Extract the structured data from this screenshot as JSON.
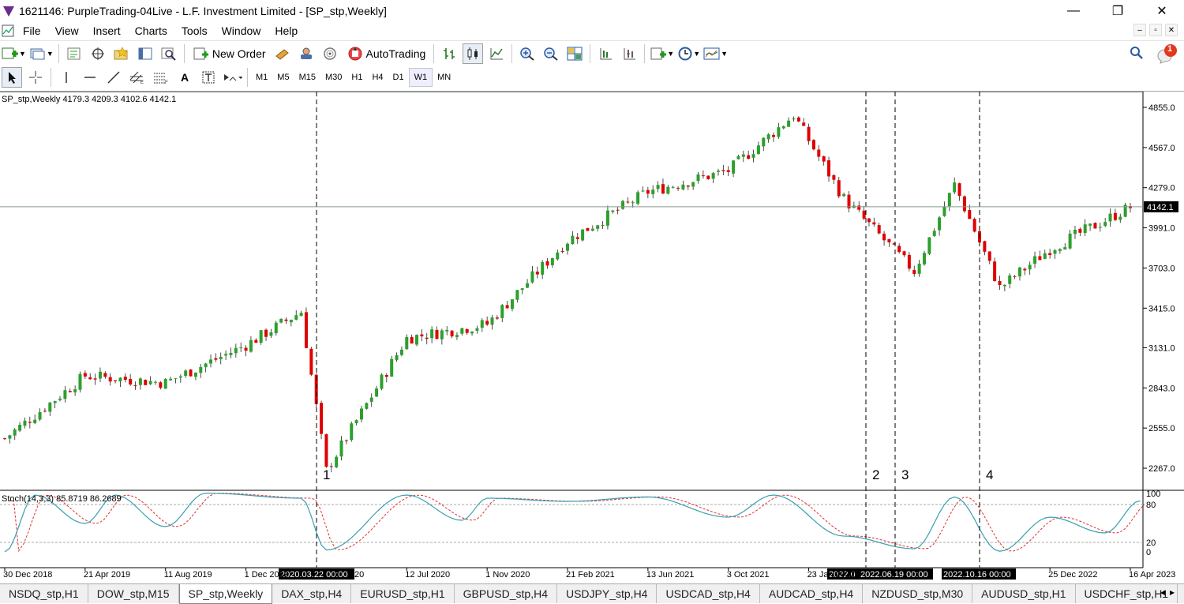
{
  "window": {
    "title": "1621146: PurpleTrading-04Live - L.F. Investment Limited - [SP_stp,Weekly]",
    "minimize": "—",
    "maximize": "❐",
    "close": "✕"
  },
  "menu": [
    "File",
    "View",
    "Insert",
    "Charts",
    "Tools",
    "Window",
    "Help"
  ],
  "toolbar": {
    "new_order": "New Order",
    "autotrading": "AutoTrading",
    "notification_count": "1"
  },
  "timeframes": [
    "M1",
    "M5",
    "M15",
    "M30",
    "H1",
    "H4",
    "D1",
    "W1",
    "MN"
  ],
  "active_timeframe": "W1",
  "chart": {
    "symbol_info": "SP_stp,Weekly  4179.3 4209.3 4102.6 4142.1",
    "stoch_info": "Stoch(14,3,3) 85.8719 86.2689",
    "current_price": "4142.1",
    "y_ticks": [
      "4855.0",
      "4567.0",
      "4279.0",
      "3991.0",
      "3703.0",
      "3415.0",
      "3131.0",
      "2843.0",
      "2555.0",
      "2267.0"
    ],
    "stoch_ticks": [
      "100",
      "80",
      "20",
      "0"
    ],
    "x_ticks": [
      "30 Dec 2018",
      "21 Apr 2019",
      "11 Aug 2019",
      "1 Dec 2019",
      "12 Jul 2020",
      "1 Nov 2020",
      "21 Feb 2021",
      "13 Jun 2021",
      "3 Oct 2021",
      "23 Jan 2022",
      "25 Dec 2022",
      "16 Apr 2023"
    ],
    "x_tick_prefix_hidden_behind_label": "20",
    "vline_labels": [
      "2020.03.22 00:00",
      "2022.0",
      "2022.06.19 00:00",
      "2022.10.16 00:00"
    ],
    "markers": [
      "1",
      "2",
      "3",
      "4"
    ],
    "colors": {
      "up": "#2ca02c",
      "down": "#e00000",
      "stoch_main": "#3a9fb0",
      "stoch_signal": "#e03030",
      "grid": "#999999"
    }
  },
  "chart_data": {
    "type": "candlestick",
    "symbol": "SP_stp",
    "timeframe": "Weekly",
    "last_bar": {
      "open": 4179.3,
      "high": 4209.3,
      "low": 4102.6,
      "close": 4142.1
    },
    "ylim": [
      2180,
      4930
    ],
    "key_points": [
      {
        "date": "2018-12-30",
        "price": 2480
      },
      {
        "date": "2019-04-21",
        "price": 2930
      },
      {
        "date": "2019-08-11",
        "price": 2880
      },
      {
        "date": "2019-12-01",
        "price": 3150
      },
      {
        "date": "2020-02-16",
        "price": 3390
      },
      {
        "date": "2020-03-22",
        "price": 2250
      },
      {
        "date": "2020-07-12",
        "price": 3200
      },
      {
        "date": "2020-11-01",
        "price": 3300
      },
      {
        "date": "2021-02-21",
        "price": 3900
      },
      {
        "date": "2021-06-13",
        "price": 4250
      },
      {
        "date": "2021-10-03",
        "price": 4400
      },
      {
        "date": "2022-01-02",
        "price": 4800
      },
      {
        "date": "2022-03-13",
        "price": 4200
      },
      {
        "date": "2022-06-19",
        "price": 3680
      },
      {
        "date": "2022-08-14",
        "price": 4300
      },
      {
        "date": "2022-10-16",
        "price": 3560
      },
      {
        "date": "2022-12-25",
        "price": 3840
      },
      {
        "date": "2023-04-16",
        "price": 4140
      }
    ],
    "stoch_points": [
      {
        "date": "2018-12-30",
        "value": 5
      },
      {
        "date": "2019-02-10",
        "value": 95
      },
      {
        "date": "2019-04-21",
        "value": 50
      },
      {
        "date": "2019-06-02",
        "value": 95
      },
      {
        "date": "2019-08-11",
        "value": 45
      },
      {
        "date": "2019-10-06",
        "value": 98
      },
      {
        "date": "2020-02-16",
        "value": 90
      },
      {
        "date": "2020-03-22",
        "value": 8
      },
      {
        "date": "2020-07-12",
        "value": 95
      },
      {
        "date": "2020-09-27",
        "value": 55
      },
      {
        "date": "2020-11-01",
        "value": 90
      },
      {
        "date": "2021-02-21",
        "value": 85
      },
      {
        "date": "2021-06-13",
        "value": 92
      },
      {
        "date": "2021-10-03",
        "value": 60
      },
      {
        "date": "2021-12-05",
        "value": 95
      },
      {
        "date": "2022-03-13",
        "value": 30
      },
      {
        "date": "2022-06-19",
        "value": 10
      },
      {
        "date": "2022-08-14",
        "value": 92
      },
      {
        "date": "2022-10-16",
        "value": 6
      },
      {
        "date": "2022-12-25",
        "value": 60
      },
      {
        "date": "2023-03-12",
        "value": 35
      },
      {
        "date": "2023-04-30",
        "value": 86
      }
    ]
  }
}
